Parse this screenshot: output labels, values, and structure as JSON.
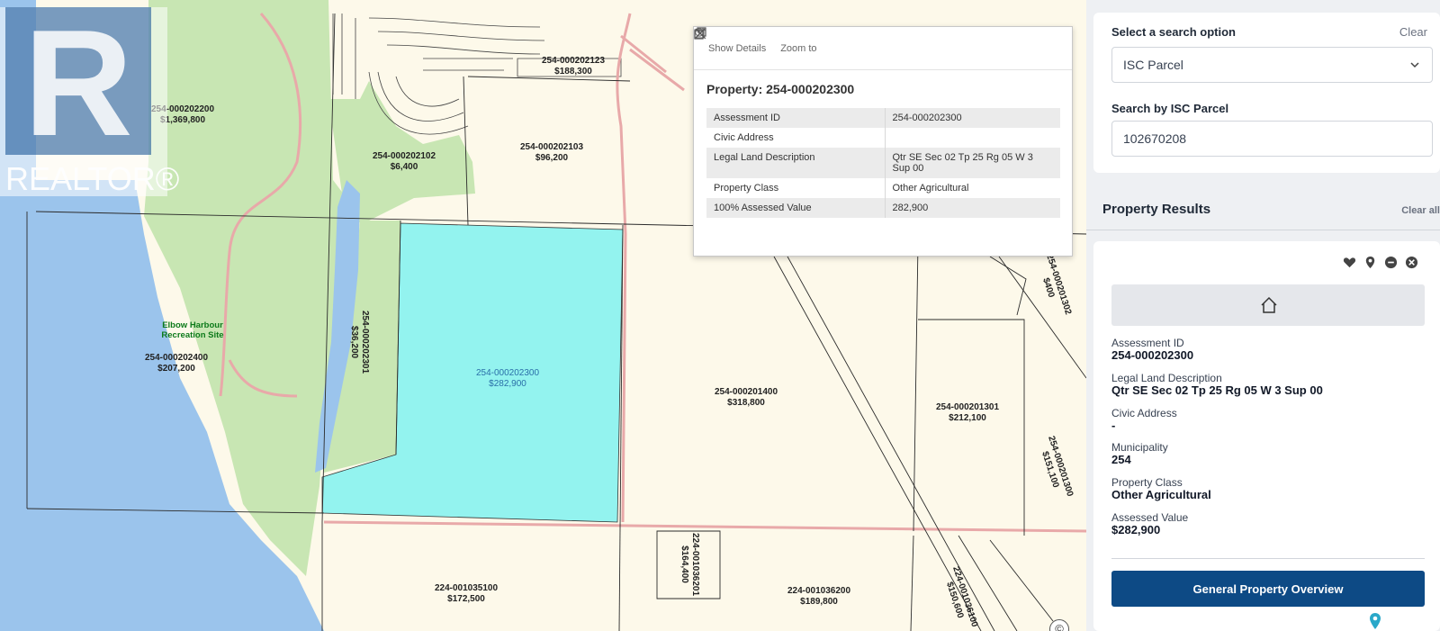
{
  "map": {
    "parcels": [
      {
        "id": "254-000202200",
        "value": "$1,369,800"
      },
      {
        "id": "254-000202123",
        "value": "$188,300"
      },
      {
        "id": "254-000202102",
        "value": "$6,400"
      },
      {
        "id": "254-000202103",
        "value": "$96,200"
      },
      {
        "id": "254-000202301",
        "value": "$36,200"
      },
      {
        "id": "254-000202400",
        "value": "$207,200"
      },
      {
        "id": "254-000202300",
        "value": "$282,900"
      },
      {
        "id": "254-000201400",
        "value": "$318,800"
      },
      {
        "id": "254-000201301",
        "value": "$212,100"
      },
      {
        "id": "254-000201302",
        "value": "$400"
      },
      {
        "id": "254-000201300",
        "value": "$151,100"
      },
      {
        "id": "224-001035100",
        "value": "$172,500"
      },
      {
        "id": "224-001036201",
        "value": "$164,400"
      },
      {
        "id": "224-001036200",
        "value": "$189,800"
      },
      {
        "id": "224-001036100",
        "value": "$150,600"
      }
    ],
    "site_label_line1": "Elbow Harbour",
    "site_label_line2": "Recreation Site",
    "watermark": {
      "letter": "R",
      "text": "REALTOR®"
    },
    "attribution_symbol": "©",
    "colors": {
      "water": "#9bc4ec",
      "park": "#c8e6b3",
      "land": "#fdf9ea",
      "selected": "#93f3ef",
      "road": "#e8a9a9"
    }
  },
  "popup": {
    "show_details": "Show Details",
    "zoom_to": "Zoom to",
    "title": "Property: 254-000202300",
    "rows": [
      {
        "label": "Assessment ID",
        "value": "254-000202300"
      },
      {
        "label": "Civic Address",
        "value": ""
      },
      {
        "label": "Legal Land Description",
        "value": "Qtr SE Sec 02 Tp 25 Rg 05 W 3 Sup 00"
      },
      {
        "label": "Property Class",
        "value": "Other Agricultural"
      },
      {
        "label": "100% Assessed Value",
        "value": "282,900"
      }
    ]
  },
  "sidebar": {
    "search_option_label": "Select a search option",
    "clear": "Clear",
    "search_option_value": "ISC Parcel",
    "search_by_label": "Search by ISC Parcel",
    "search_value": "102670208",
    "results_title": "Property Results",
    "clear_all": "Clear all",
    "result": {
      "assessment_id_label": "Assessment ID",
      "assessment_id": "254-000202300",
      "legal_label": "Legal Land Description",
      "legal": "Qtr SE Sec 02 Tp 25 Rg 05 W 3 Sup 00",
      "civic_label": "Civic Address",
      "civic": "-",
      "municipality_label": "Municipality",
      "municipality": "254",
      "class_label": "Property Class",
      "class": "Other Agricultural",
      "value_label": "Assessed Value",
      "value": "$282,900",
      "button": "General Property Overview"
    }
  }
}
